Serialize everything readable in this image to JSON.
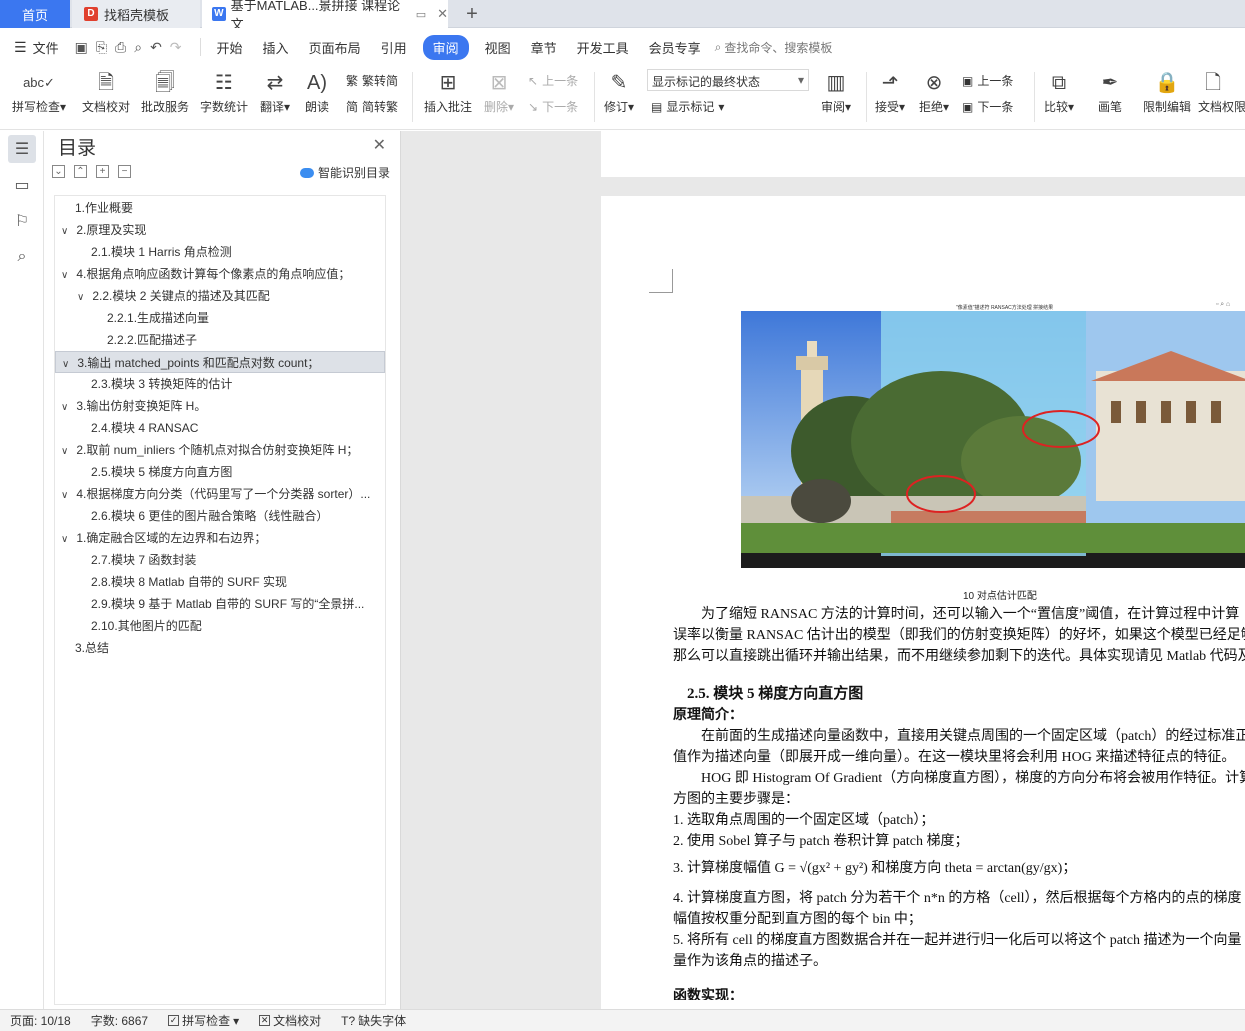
{
  "tabs": {
    "home": "首页",
    "daoke": "找稻壳模板",
    "document": "基于MATLAB...景拼接 课程论文",
    "add": "+"
  },
  "menu": {
    "file": "文件",
    "items": [
      "开始",
      "插入",
      "页面布局",
      "引用",
      "审阅",
      "视图",
      "章节",
      "开发工具",
      "会员专享"
    ],
    "active_index": 4,
    "search_placeholder": "查找命令、搜索模板"
  },
  "ribbon": {
    "spellcheck": "拼写检查",
    "doc_proof": "文档校对",
    "batch_service": "批改服务",
    "word_count": "字数统计",
    "translate": "翻译",
    "read_aloud": "朗读",
    "to_traditional": "繁转简",
    "to_simplified": "简转繁",
    "insert_comment": "插入批注",
    "delete": "删除",
    "prev": "上一条",
    "next": "下一条",
    "revise": "修订",
    "markup_select": "显示标记的最终状态",
    "show_markup": "显示标记",
    "review": "审阅",
    "accept": "接受",
    "reject": "拒绝",
    "prev2": "上一条",
    "next2": "下一条",
    "compare": "比较",
    "pen": "画笔",
    "restrict_edit": "限制编辑",
    "doc_permission": "文档权限"
  },
  "toc": {
    "title": "目录",
    "smart": "智能识别目录",
    "items": [
      {
        "text": "1.作业概要",
        "level": 1,
        "arrow": false
      },
      {
        "text": "2.原理及实现",
        "level": 1,
        "arrow": true
      },
      {
        "text": "2.1.模块 1 Harris 角点检测",
        "level": 2,
        "arrow": false
      },
      {
        "text": "4.根据角点响应函数计算每个像素点的角点响应值；",
        "level": 1,
        "arrow": true
      },
      {
        "text": "2.2.模块 2  关键点的描述及其匹配",
        "level": 2,
        "arrow": true
      },
      {
        "text": "2.2.1.生成描述向量",
        "level": 3,
        "arrow": false
      },
      {
        "text": "2.2.2.匹配描述子",
        "level": 3,
        "arrow": false
      },
      {
        "text": "3.输出 matched_points 和匹配点对数 count；",
        "level": 1,
        "arrow": true,
        "selected": true
      },
      {
        "text": "2.3.模块 3  转换矩阵的估计",
        "level": 2,
        "arrow": false
      },
      {
        "text": "3.输出仿射变换矩阵 H。",
        "level": 1,
        "arrow": true
      },
      {
        "text": "2.4.模块 4 RANSAC",
        "level": 2,
        "arrow": false
      },
      {
        "text": "2.取前 num_inliers 个随机点对拟合仿射变换矩阵 H；",
        "level": 1,
        "arrow": true
      },
      {
        "text": "2.5.模块 5  梯度方向直方图",
        "level": 2,
        "arrow": false
      },
      {
        "text": "4.根据梯度方向分类（代码里写了一个分类器 sorter）...",
        "level": 1,
        "arrow": true
      },
      {
        "text": "2.6.模块 6  更佳的图片融合策略（线性融合）",
        "level": 2,
        "arrow": false
      },
      {
        "text": "1.确定融合区域的左边界和右边界；",
        "level": 1,
        "arrow": true
      },
      {
        "text": "2.7.模块 7  函数封装",
        "level": 2,
        "arrow": false
      },
      {
        "text": "2.8.模块 8 Matlab 自带的 SURF 实现",
        "level": 2,
        "arrow": false
      },
      {
        "text": "2.9.模块 9  基于 Matlab 自带的 SURF 写的“全景拼...",
        "level": 2,
        "arrow": false
      },
      {
        "text": "2.10.其他图片的匹配",
        "level": 2,
        "arrow": false
      },
      {
        "text": "3.总结",
        "level": 1,
        "arrow": false
      }
    ]
  },
  "document": {
    "figure_title": "\"像素值\"描述符 RANSAC方法处理 拼接结果",
    "caption": "10 对点估计匹配",
    "para1": [
      "　　为了缩短 RANSAC 方法的计算时间，还可以输入一个“置信度”阈值，在计算过程中计算",
      "误率以衡量 RANSAC 估计出的模型（即我们的仿射变换矩阵）的好坏，如果这个模型已经足够",
      "那么可以直接跳出循环并输出结果，而不用继续参加剩下的迭代。具体实现请见 Matlab 代码及"
    ],
    "heading": "2.5.   模块 5  梯度方向直方图",
    "subheading": "原理简介：",
    "para2": [
      "　　在前面的生成描述向量函数中，直接用关键点周围的一个固定区域（patch）的经过标准正",
      "值作为描述向量（即展开成一维向量）。在这一模块里将会利用 HOG 来描述特征点的特征。",
      "　　HOG 即 Histogram Of Gradient（方向梯度直方图），梯度的方向分布将会被用作特征。计算",
      "方图的主要步骤是："
    ],
    "steps": [
      "1.    选取角点周围的一个固定区域（patch）；",
      "2.    使用 Sobel 算子与 patch 卷积计算 patch 梯度；",
      "3.    计算梯度幅值 G = √(gx² + gy²) 和梯度方向 theta = arctan(gy/gx)；",
      "4.    计算梯度直方图，将 patch 分为若干个 n*n 的方格（cell），然后根据每个方格内的点的梯度",
      "       幅值按权重分配到直方图的每个 bin 中；",
      "5.    将所有 cell 的梯度直方图数据合并在一起并进行归一化后可以将这个 patch 描述为一个向量",
      "       量作为该角点的描述子。"
    ],
    "cut_heading": "函数实现："
  },
  "status": {
    "page": "页面: 10/18",
    "words": "字数: 6867",
    "spellcheck": "拼写检查",
    "doc_proof": "文档校对",
    "missing_font": "缺失字体"
  }
}
